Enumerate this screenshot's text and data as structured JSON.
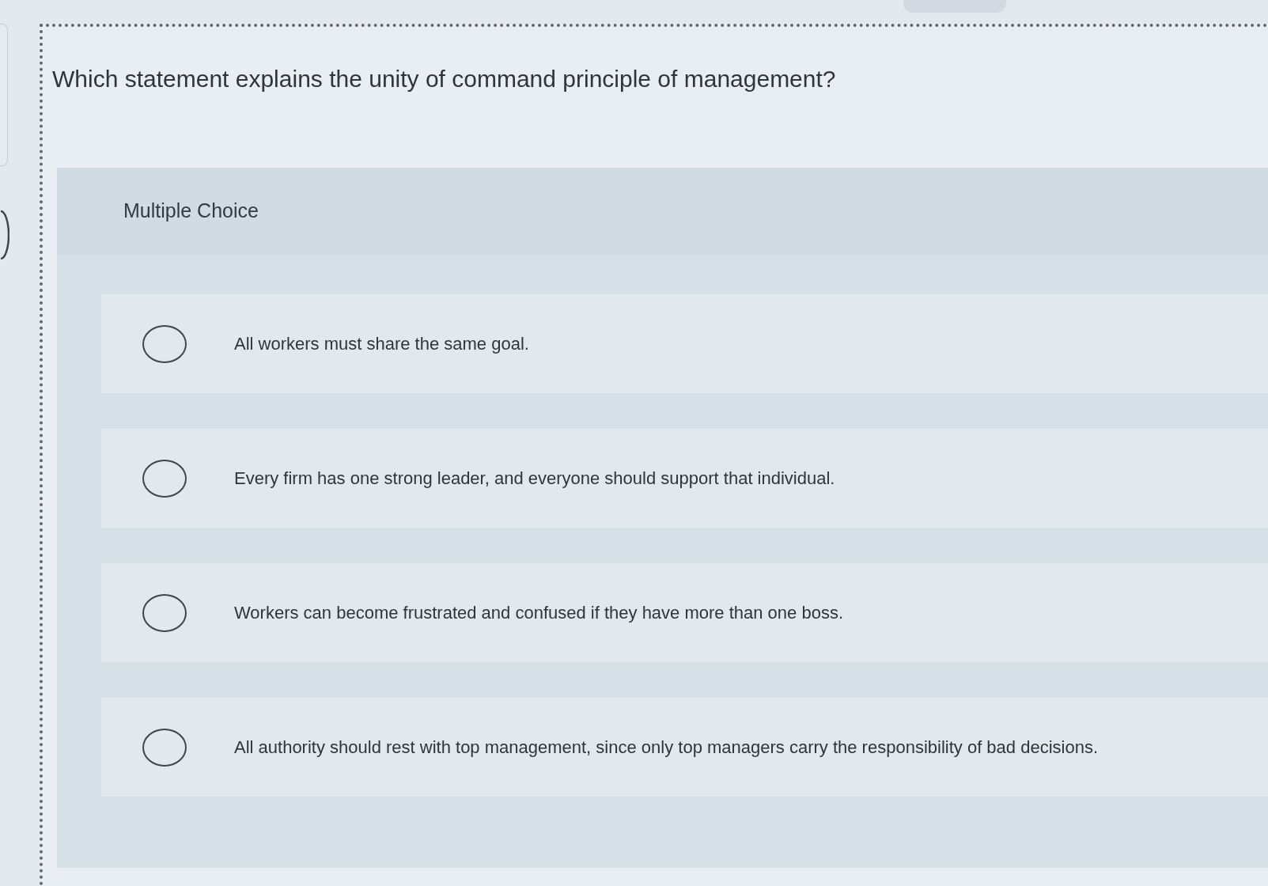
{
  "question": {
    "text": "Which statement explains the unity of command principle of management?"
  },
  "answer_panel": {
    "label": "Multiple Choice",
    "options": [
      {
        "text": "All workers must share the same goal.",
        "selected": false
      },
      {
        "text": "Every firm has one strong leader, and everyone should support that individual.",
        "selected": false
      },
      {
        "text": "Workers can become frustrated and confused if they have more than one boss.",
        "selected": false
      },
      {
        "text": "All authority should rest with top management, since only top managers carry the responsibility of bad decisions.",
        "selected": false
      }
    ]
  }
}
